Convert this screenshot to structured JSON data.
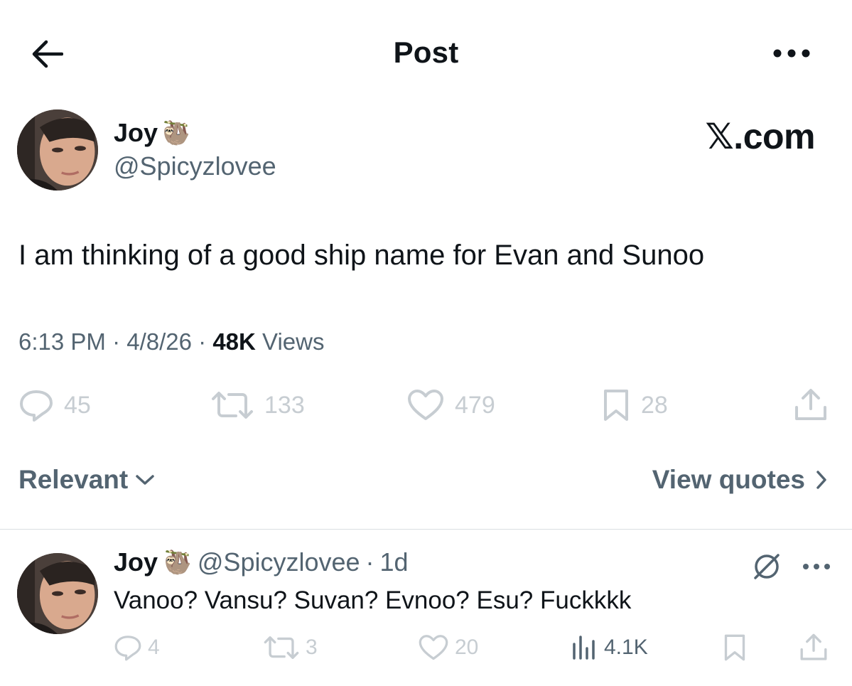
{
  "header": {
    "title": "Post",
    "back_icon": "arrow-left-icon",
    "more_icon": "more-horizontal-icon"
  },
  "post": {
    "author": {
      "name": "Joy",
      "emoji": "🦥",
      "handle": "@Spicyzlovee"
    },
    "brand_watermark": "𝕏.com",
    "text": "I am thinking of a good ship name for Evan and Sunoo",
    "meta": {
      "time": "6:13 PM",
      "sep1": " · ",
      "date": "4/8/26",
      "sep2": " · ",
      "views": "48K",
      "views_label": " Views"
    },
    "actions": {
      "replies": "45",
      "reposts": "133",
      "likes": "479",
      "bookmarks": "28"
    }
  },
  "sort": {
    "relevant_label": "Relevant",
    "view_quotes_label": "View quotes"
  },
  "reply": {
    "name": "Joy",
    "emoji": "🦥",
    "handle": "@Spicyzlovee",
    "dot": "·",
    "time": "1d",
    "text": "Vanoo? Vansu? Suvan? Evnoo? Esu? Fuckkkk",
    "actions": {
      "replies": "4",
      "reposts": "3",
      "likes": "20",
      "views": "4.1K"
    }
  },
  "colors": {
    "text_primary": "#0f1419",
    "text_secondary": "#536471",
    "action_faded": "#c7cdd2",
    "divider": "#d9dee2"
  }
}
